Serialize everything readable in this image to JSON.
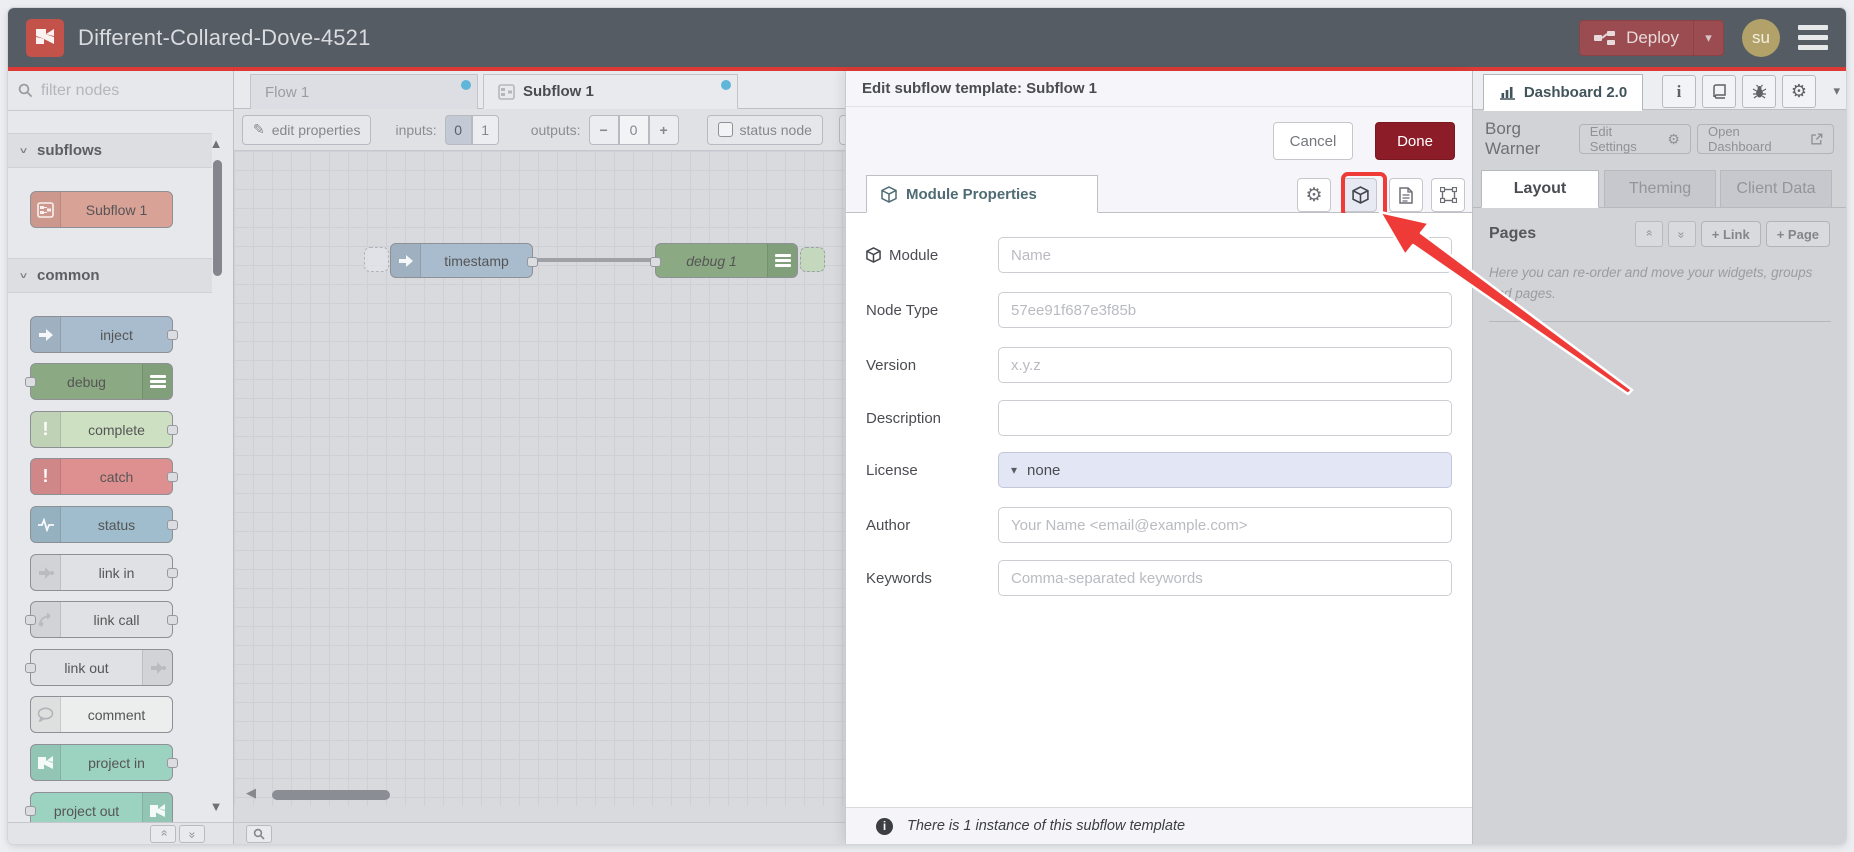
{
  "header": {
    "title": "Different-Collared-Dove-4521",
    "deploy_label": "Deploy",
    "avatar_initials": "su"
  },
  "palette": {
    "filter_placeholder": "filter nodes",
    "subflows_label": "subflows",
    "subflow_node": "Subflow 1",
    "common_label": "common",
    "nodes": [
      "inject",
      "debug",
      "complete",
      "catch",
      "status",
      "link in",
      "link call",
      "link out",
      "comment",
      "project in",
      "project out"
    ]
  },
  "tabs": {
    "flow1": "Flow 1",
    "subflow1": "Subflow 1"
  },
  "toolbar": {
    "edit_properties": "edit properties",
    "inputs_label": "inputs:",
    "input_opt_0": "0",
    "input_opt_1": "1",
    "outputs_label": "outputs:",
    "outputs_value": "0",
    "minus": "−",
    "plus": "+",
    "status_node_label": "status node"
  },
  "canvas": {
    "nodes": [
      {
        "label": "timestamp"
      },
      {
        "label": "debug 1"
      }
    ]
  },
  "dialog": {
    "title": "Edit subflow template: Subflow 1",
    "cancel_label": "Cancel",
    "done_label": "Done",
    "tab_label": "Module Properties",
    "fields": [
      {
        "label": "Module",
        "placeholder": "Name"
      },
      {
        "label": "Node Type",
        "placeholder": "57ee91f687e3f85b"
      },
      {
        "label": "Version",
        "placeholder": "x.y.z"
      },
      {
        "label": "Description",
        "placeholder": ""
      },
      {
        "label": "License",
        "value": "none"
      },
      {
        "label": "Author",
        "placeholder": "Your Name <email@example.com>"
      },
      {
        "label": "Keywords",
        "placeholder": "Comma-separated keywords"
      }
    ],
    "footer_text": "There is 1 instance of this subflow template"
  },
  "sidebar": {
    "tab_label": "Dashboard 2.0",
    "project_name": "Borg Warner",
    "edit_settings_label": "Edit Settings",
    "open_dashboard_label": "Open Dashboard",
    "tabs": [
      "Layout",
      "Theming",
      "Client Data"
    ],
    "pages_title": "Pages",
    "link_button": "+ Link",
    "page_button": "+ Page",
    "help_text": "Here you can re-order and move your widgets, groups and pages."
  },
  "icons": {
    "caret_down": "▾",
    "chevron_double": "»",
    "scroll_up": "▲",
    "scroll_down": "▼",
    "scroll_left": "◀",
    "gear": "⚙",
    "pencil": "✎",
    "info_i": "i",
    "excl": "!"
  },
  "colors": {
    "header_bg": "#565c64",
    "accent_line": "#dd3a35",
    "deploy_bg": "#9a4c50",
    "done_bg": "#8c1c28",
    "highlight_red": "#ee3b38",
    "tab_dot": "#5fb6d8",
    "node_subflow": "#d9a296",
    "node_inject": "#a9bcce",
    "node_debug": "#8ba983",
    "node_complete": "#cde0c2",
    "node_catch": "#de9090",
    "node_status": "#9fbdcd",
    "node_link": "#e0e1e4",
    "node_comment": "#eceded",
    "node_project": "#9cd2c0",
    "license_bg": "#e3e7f5"
  }
}
